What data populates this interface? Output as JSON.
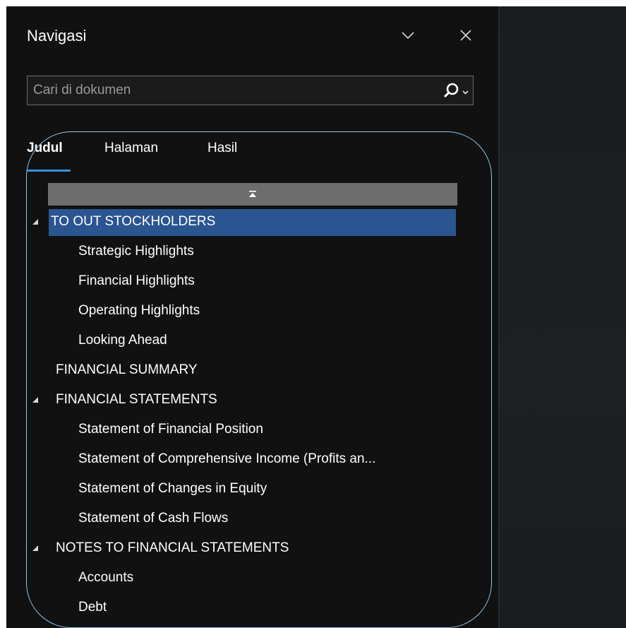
{
  "panel": {
    "title": "Navigasi"
  },
  "search": {
    "placeholder": "Cari di dokumen",
    "value": ""
  },
  "tabs": [
    {
      "label": "Judul",
      "active": true
    },
    {
      "label": "Halaman",
      "active": false
    },
    {
      "label": "Hasil",
      "active": false
    }
  ],
  "tree": [
    {
      "label": "TO OUT STOCKHOLDERS",
      "level": 0,
      "expanded": true,
      "selected": true
    },
    {
      "label": "Strategic Highlights",
      "level": 1
    },
    {
      "label": "Financial Highlights",
      "level": 1
    },
    {
      "label": "Operating Highlights",
      "level": 1
    },
    {
      "label": "Looking Ahead",
      "level": 1
    },
    {
      "label": "FINANCIAL SUMMARY",
      "level": 0
    },
    {
      "label": "FINANCIAL STATEMENTS",
      "level": 0,
      "expanded": true
    },
    {
      "label": "Statement of Financial Position",
      "level": 1
    },
    {
      "label": "Statement of Comprehensive Income (Profits an...",
      "level": 1
    },
    {
      "label": "Statement of Changes in Equity",
      "level": 1
    },
    {
      "label": "Statement of Cash Flows",
      "level": 1
    },
    {
      "label": "NOTES TO FINANCIAL STATEMENTS",
      "level": 0,
      "expanded": true
    },
    {
      "label": "Accounts",
      "level": 1
    },
    {
      "label": "Debt",
      "level": 1
    }
  ],
  "colors": {
    "panel_bg": "#111111",
    "selection": "#2b5591",
    "tab_accent": "#3b8fe0",
    "annotation_ring": "#8fc6ec"
  },
  "icons": [
    "chevron-down-icon",
    "close-icon",
    "search-icon",
    "dropdown-caret-icon",
    "scroll-to-top-icon",
    "expanded-triangle-icon"
  ]
}
